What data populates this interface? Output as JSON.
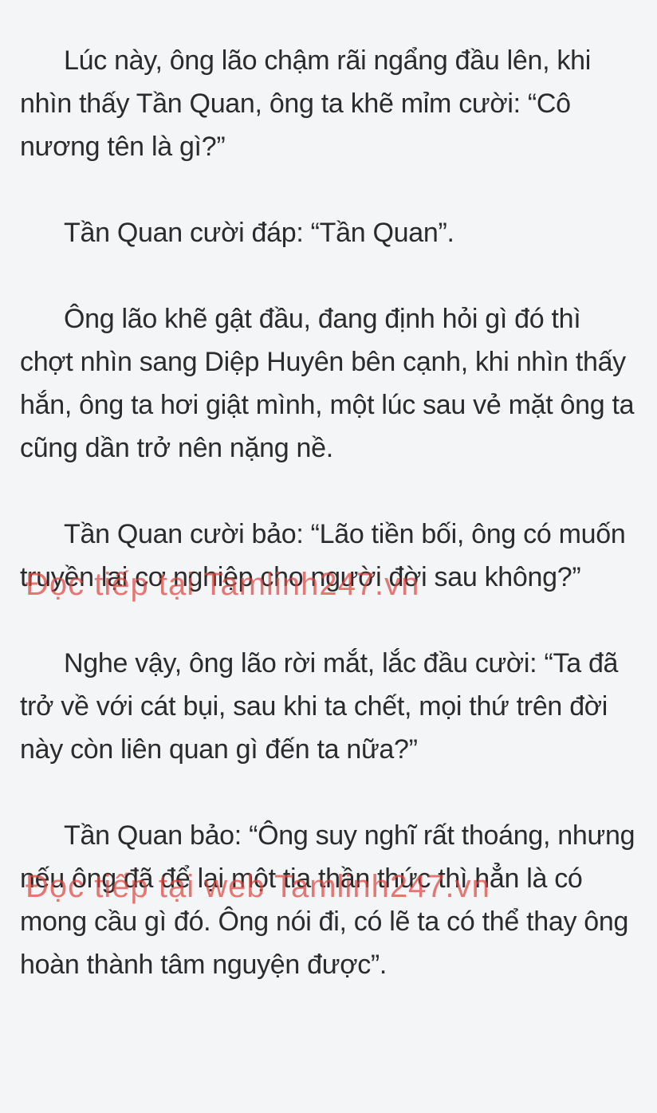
{
  "paragraphs": [
    "Lúc này, ông lão chậm rãi ngẩng đầu lên, khi nhìn thấy Tần Quan, ông ta khẽ mỉm cười: “Cô nương tên là gì?”",
    "Tần Quan cười đáp: “Tần Quan”.",
    "Ông lão khẽ gật đầu, đang định hỏi gì đó thì chợt nhìn sang Diệp Huyên bên cạnh, khi nhìn thấy hắn, ông ta hơi giật mình, một lúc sau vẻ mặt ông ta cũng dần trở nên nặng nề.",
    "Tần Quan cười bảo: “Lão tiền bối, ông có muốn truyền lại cơ nghiệp cho người đời sau không?”",
    "Nghe vậy, ông lão rời mắt, lắc đầu cười: “Ta đã trở về với cát bụi, sau khi ta chết, mọi thứ trên đời này còn liên quan gì đến ta nữa?”",
    "Tần Quan bảo: “Ông suy nghĩ rất thoáng, nhưng nếu ông đã để lại một tia thần thức thì hẳn là có mong cầu gì đó. Ông nói đi, có lẽ ta có thể thay ông hoàn thành tâm nguyện được”."
  ],
  "watermarks": [
    "Đọc tiếp tại Tamlinh247.vn",
    "Đọc tiếp tại web Tamlinh247.vn"
  ],
  "colors": {
    "background": "#f4f5f7",
    "text": "#2b2b2b",
    "watermark": "#de4640"
  }
}
